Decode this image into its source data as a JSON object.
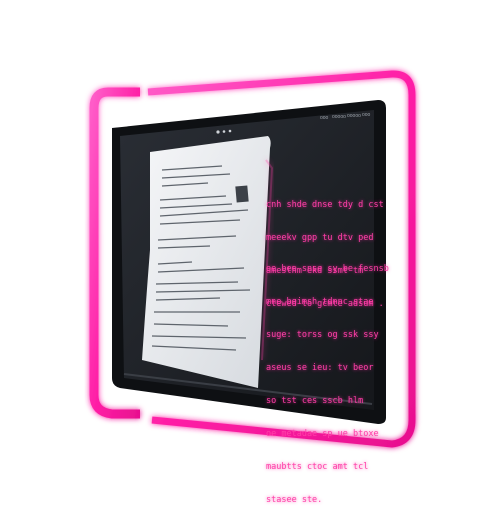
{
  "image": {
    "subject": "tablet",
    "frame_color": "#ff2fb4",
    "screen_color": "#1c1f24",
    "glow_color": "#ff3fa8",
    "paper_color": "#eef0f2"
  },
  "screen": {
    "top_bar": {
      "nav_items": [
        "ooo",
        "ooooo",
        "ooooo",
        "ooo"
      ]
    },
    "glow_text_blocks": [
      {
        "lines": [
          "cnh shde dnse tdy d cst",
          "meeekv gpp tu dtv ped",
          "amesthm ekd ssmt tm",
          "ctewed to gcmte adsum ."
        ]
      },
      {
        "lines": [
          "oe bee snse sy be fesnsb",
          "mne beimsh tdnnc stae",
          "suge: torss og ssk ssy",
          "aseus se ieu: tv beor",
          "so tst ces sscb hlm",
          "oe metadae sp ue btoxe",
          "maubtts ctoc amt tcl",
          "stasee ste."
        ]
      }
    ]
  }
}
